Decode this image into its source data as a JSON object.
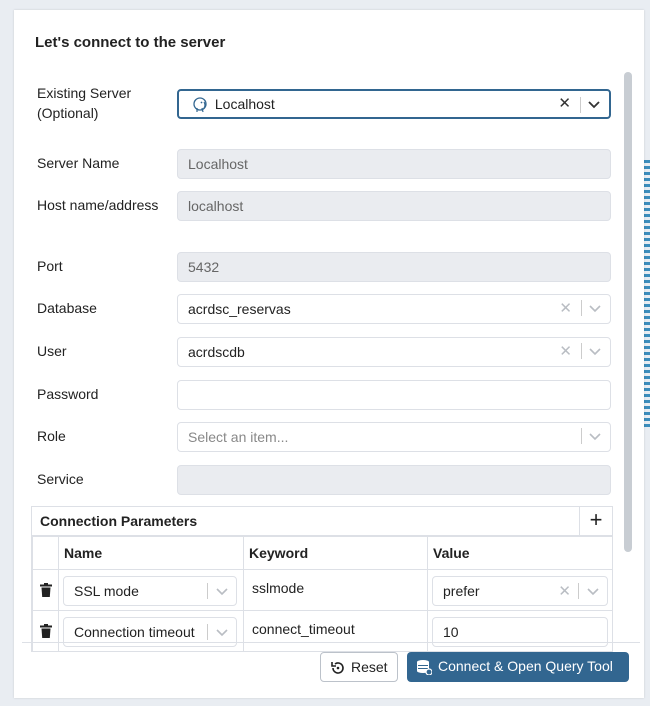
{
  "dialog": {
    "title": "Let's connect to the server"
  },
  "form": {
    "existing_server": {
      "label": "Existing Server (Optional)",
      "value": "Localhost"
    },
    "server_name": {
      "label": "Server Name",
      "value": "Localhost"
    },
    "host": {
      "label": "Host name/address",
      "value": "localhost"
    },
    "port": {
      "label": "Port",
      "value": "5432"
    },
    "database": {
      "label": "Database",
      "value": "acrdsc_reservas"
    },
    "user": {
      "label": "User",
      "value": "acrdscdb"
    },
    "password": {
      "label": "Password",
      "value": ""
    },
    "role": {
      "label": "Role",
      "placeholder": "Select an item..."
    },
    "service": {
      "label": "Service",
      "value": ""
    }
  },
  "params": {
    "title": "Connection Parameters",
    "add_label": "+",
    "columns": [
      "Name",
      "Keyword",
      "Value"
    ],
    "rows": [
      {
        "name": "SSL mode",
        "keyword": "sslmode",
        "value": "prefer"
      },
      {
        "name": "Connection timeout",
        "keyword": "connect_timeout",
        "value": "10"
      }
    ]
  },
  "buttons": {
    "reset": "Reset",
    "connect": "Connect & Open Query Tool"
  },
  "colors": {
    "primary": "#326690",
    "border": "#dde0e6",
    "disabled_bg": "#eaecf0"
  },
  "icons": {
    "server": "postgres-elephant-icon",
    "clear": "clear-x-icon",
    "dropdown": "chevron-down-icon",
    "delete": "trash-icon",
    "add": "plus-icon",
    "reset": "reset-icon",
    "connect": "query-tool-icon"
  }
}
